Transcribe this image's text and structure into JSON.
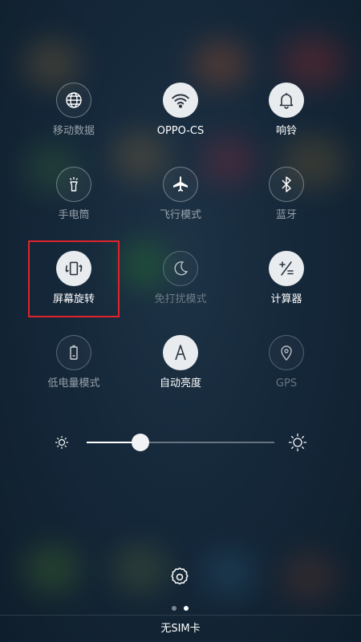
{
  "tiles": [
    {
      "label": "移动数据",
      "icon": "globe-icon",
      "state": "off"
    },
    {
      "label": "OPPO-CS",
      "icon": "wifi-icon",
      "state": "on"
    },
    {
      "label": "响铃",
      "icon": "bell-icon",
      "state": "on"
    },
    {
      "label": "手电筒",
      "icon": "flashlight-icon",
      "state": "off"
    },
    {
      "label": "飞行模式",
      "icon": "airplane-icon",
      "state": "off"
    },
    {
      "label": "蓝牙",
      "icon": "bluetooth-icon",
      "state": "off"
    },
    {
      "label": "屏幕旋转",
      "icon": "screen-rotation-icon",
      "state": "on"
    },
    {
      "label": "免打扰模式",
      "icon": "moon-icon",
      "state": "off"
    },
    {
      "label": "计算器",
      "icon": "calculator-icon",
      "state": "on"
    },
    {
      "label": "低电量模式",
      "icon": "battery-icon",
      "state": "off"
    },
    {
      "label": "自动亮度",
      "icon": "auto-brightness-icon",
      "state": "on"
    },
    {
      "label": "GPS",
      "icon": "location-pin-icon",
      "state": "off"
    }
  ],
  "brightness": {
    "level": 0.28
  },
  "page_indicator": {
    "active_index": 1,
    "count": 2
  },
  "sim_status": "无SIM卡",
  "colors": {
    "highlight": "#e0232a",
    "tile_on": "#e9ecef"
  }
}
